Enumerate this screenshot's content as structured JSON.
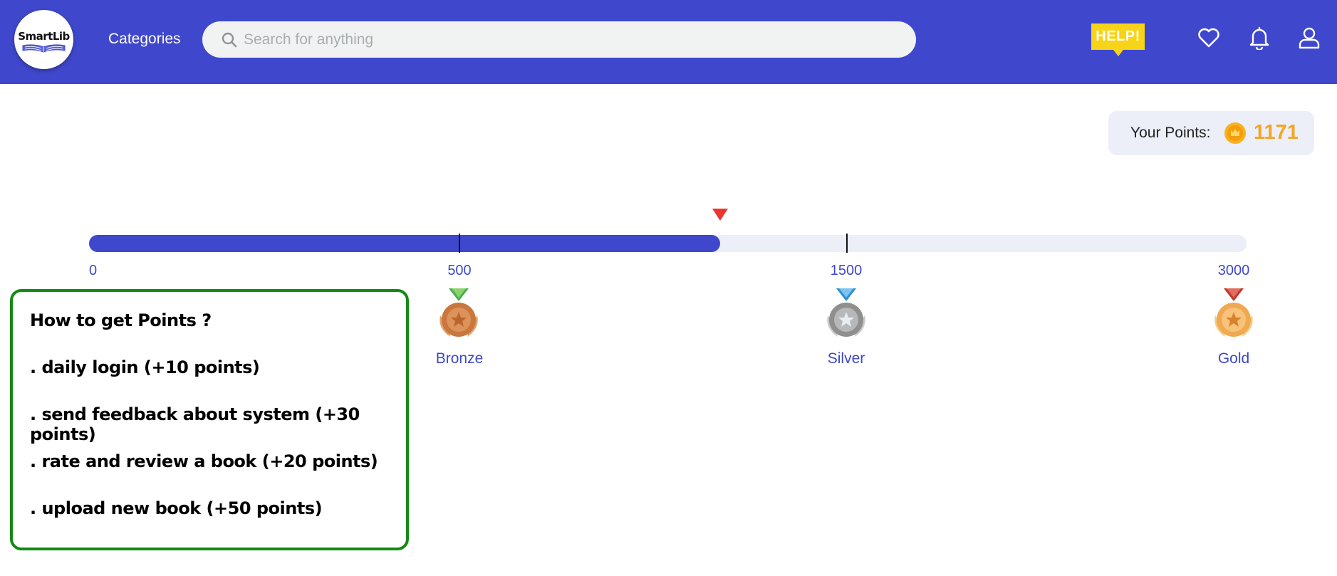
{
  "header": {
    "logo_text": "SmartLib",
    "nav_categories": "Categories",
    "search_placeholder": "Search for anything",
    "help_label": "HELP!",
    "icons": [
      "heart-icon",
      "bell-icon",
      "user-icon"
    ],
    "colors": {
      "bar": "#3f48cc",
      "help": "#f7d417"
    }
  },
  "points": {
    "label": "Your Points:",
    "value": "1171",
    "coin_icon": "coin-icon",
    "value_color": "#f5a524"
  },
  "progress": {
    "current_points": 1171,
    "max_points": 3000,
    "fill_fraction": 0.545,
    "marker_color": "#ee3333",
    "ticks": [
      {
        "label": "0"
      },
      {
        "label": "500"
      },
      {
        "label": "1500"
      },
      {
        "label": "3000"
      }
    ],
    "tiers": [
      {
        "name": "Bronze",
        "threshold": "500",
        "icon": "bronze-medal-icon"
      },
      {
        "name": "Silver",
        "threshold": "1500",
        "icon": "silver-medal-icon"
      },
      {
        "name": "Gold",
        "threshold": "3000",
        "icon": "gold-medal-icon"
      }
    ]
  },
  "info": {
    "title": "How to get Points ?",
    "items": [
      ". daily login (+10 points)",
      ". send feedback about system (+30 points)",
      ". rate and review a book (+20 points)",
      ". upload new book (+50 points)"
    ],
    "border_color": "#138a13"
  }
}
